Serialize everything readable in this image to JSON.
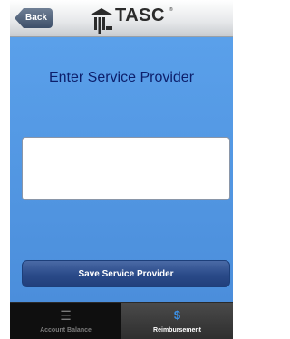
{
  "header": {
    "back_label": "Back",
    "logo_text": "TASC",
    "logo_tm": "®"
  },
  "main": {
    "title": "Enter Service Provider",
    "provider_input": {
      "value": "",
      "placeholder": ""
    },
    "save_label": "Save Service Provider"
  },
  "tabs": [
    {
      "label": "Account Balance",
      "icon": "list-icon",
      "selected": false
    },
    {
      "label": "Reimbursement",
      "icon": "dollar-icon",
      "selected": true
    }
  ],
  "colors": {
    "background": "#5c9ee6",
    "title": "#0d1f6b",
    "button": "#2a4a88",
    "tabbar": "#0f0f0f",
    "accent": "#3c90e6"
  }
}
